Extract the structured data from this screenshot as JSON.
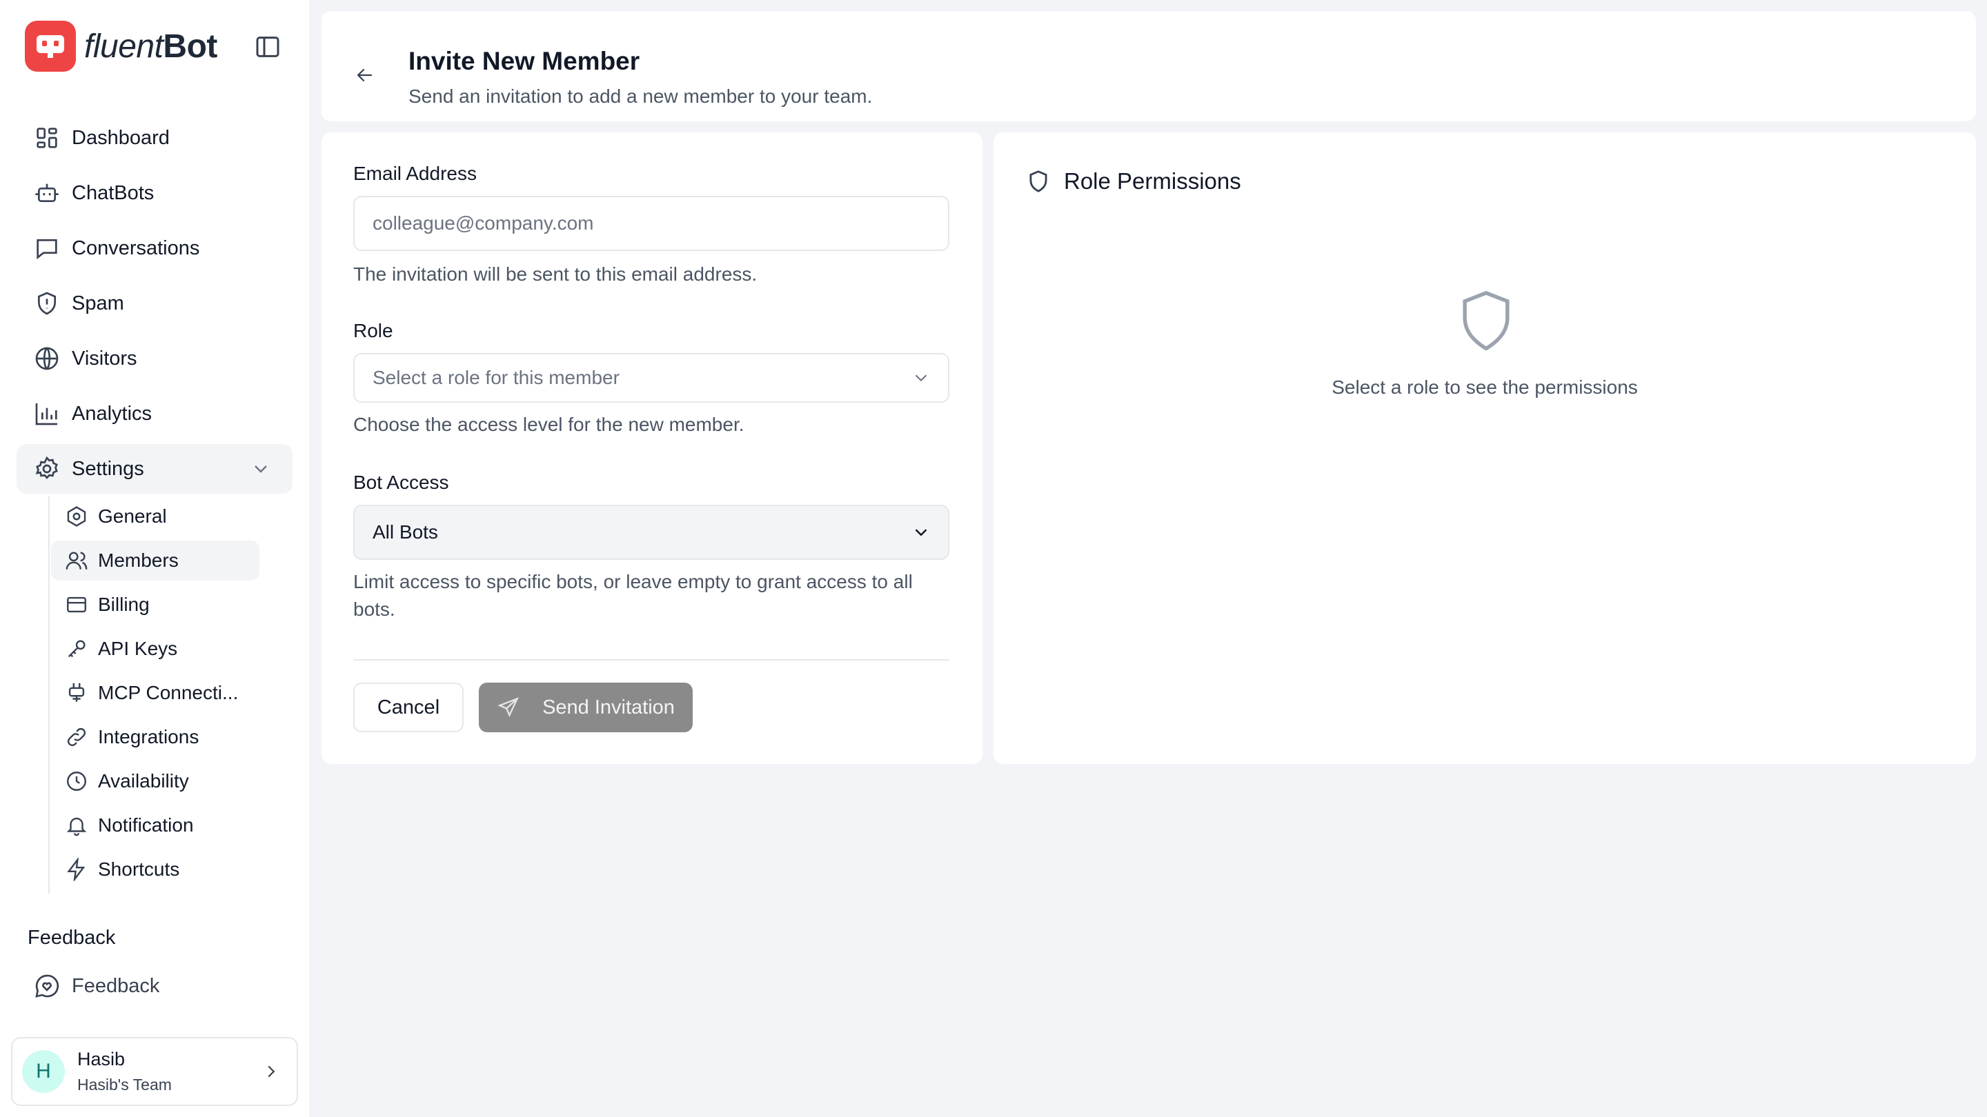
{
  "brand": {
    "name_light": "fluent",
    "name_bold": "Bot",
    "color": "#ef4444"
  },
  "nav": {
    "items": [
      {
        "label": "Dashboard",
        "icon": "dashboard-icon"
      },
      {
        "label": "ChatBots",
        "icon": "bot-icon"
      },
      {
        "label": "Conversations",
        "icon": "message-icon"
      },
      {
        "label": "Spam",
        "icon": "shield-alert-icon"
      },
      {
        "label": "Visitors",
        "icon": "globe-icon"
      },
      {
        "label": "Analytics",
        "icon": "bar-chart-icon"
      },
      {
        "label": "Settings",
        "icon": "gear-icon",
        "expanded": true
      }
    ],
    "settings_sub": [
      {
        "label": "General",
        "icon": "hexagon-icon"
      },
      {
        "label": "Members",
        "icon": "users-icon",
        "active": true
      },
      {
        "label": "Billing",
        "icon": "credit-card-icon"
      },
      {
        "label": "API Keys",
        "icon": "key-icon"
      },
      {
        "label": "MCP Connecti...",
        "icon": "plug-icon"
      },
      {
        "label": "Integrations",
        "icon": "link-icon"
      },
      {
        "label": "Availability",
        "icon": "clock-icon"
      },
      {
        "label": "Notification",
        "icon": "bell-icon"
      },
      {
        "label": "Shortcuts",
        "icon": "zap-icon"
      }
    ]
  },
  "feedback": {
    "heading": "Feedback",
    "item_label": "Feedback"
  },
  "user": {
    "initial": "H",
    "name": "Hasib",
    "team": "Hasib's Team"
  },
  "header": {
    "title": "Invite New Member",
    "subtitle": "Send an invitation to add a new member to your team."
  },
  "form": {
    "email_label": "Email Address",
    "email_placeholder": "colleague@company.com",
    "email_help": "The invitation will be sent to this email address.",
    "role_label": "Role",
    "role_placeholder": "Select a role for this member",
    "role_help": "Choose the access level for the new member.",
    "bot_access_label": "Bot Access",
    "bot_access_value": "All Bots",
    "bot_access_help": "Limit access to specific bots, or leave empty to grant access to all bots.",
    "cancel_label": "Cancel",
    "send_label": "Send Invitation"
  },
  "permissions": {
    "title": "Role Permissions",
    "empty_text": "Select a role to see the permissions"
  }
}
